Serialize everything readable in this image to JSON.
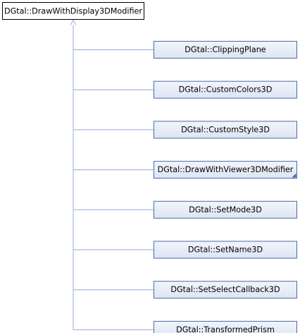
{
  "diagram": {
    "type": "class-inheritance",
    "base_class": {
      "label": "DGtal::DrawWithDisplay3DModifier"
    },
    "derived_classes": [
      {
        "label": "DGtal::ClippingPlane",
        "has_more_indicator": false
      },
      {
        "label": "DGtal::CustomColors3D",
        "has_more_indicator": false
      },
      {
        "label": "DGtal::CustomStyle3D",
        "has_more_indicator": false
      },
      {
        "label": "DGtal::DrawWithViewer3DModifier",
        "has_more_indicator": true
      },
      {
        "label": "DGtal::SetMode3D",
        "has_more_indicator": false
      },
      {
        "label": "DGtal::SetName3D",
        "has_more_indicator": false
      },
      {
        "label": "DGtal::SetSelectCallback3D",
        "has_more_indicator": false
      },
      {
        "label": "DGtal::TransformedPrism",
        "has_more_indicator": false
      }
    ],
    "colors": {
      "base_fill": "#ffffff",
      "base_border": "#000000",
      "derived_fill_top": "#f2f5fb",
      "derived_fill_bottom": "#dde5f3",
      "derived_border": "#4a6aab",
      "edge": "#96abd5",
      "indicator": "#4a6aab"
    }
  }
}
